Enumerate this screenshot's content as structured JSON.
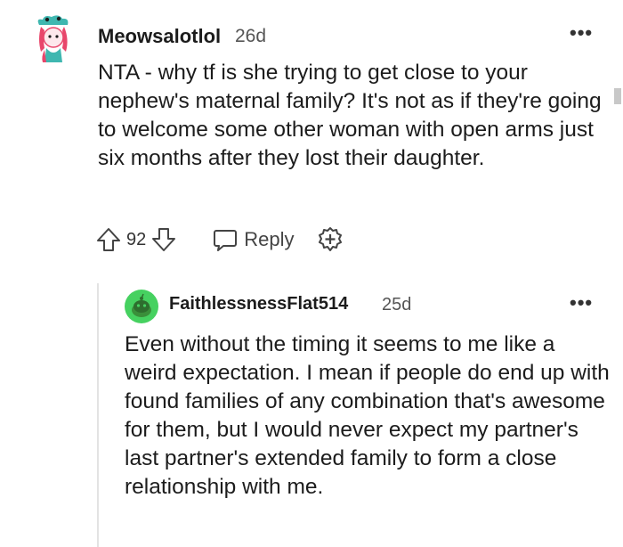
{
  "comment": {
    "author": "Meowsalotlol",
    "age": "26d",
    "more": "•••",
    "text": "NTA - why tf is she trying to get close to your nephew's maternal family? It's not as if they're going to welcome some other woman with open arms just six months after they lost their daughter.",
    "vote_count": "92",
    "reply_label": "Reply"
  },
  "reply": {
    "author": "FaithlessnessFlat514",
    "age": "25d",
    "more": "•••",
    "text": "Even without the timing it seems to me like a weird expectation. I mean if people do end up with found families of any combination that's awesome for them, but I would never expect my partner's last partner's extended family to form a close relationship with me."
  },
  "icons": {
    "upvote": "arrow-up-icon",
    "downvote": "arrow-down-icon",
    "reply": "speech-bubble-icon",
    "award": "award-plus-icon"
  },
  "colors": {
    "text": "#1c1c1c",
    "muted": "#555555",
    "avatar_pink": "#e8466b",
    "avatar_teal": "#3fb7b0",
    "avatar_green": "#46d160"
  }
}
